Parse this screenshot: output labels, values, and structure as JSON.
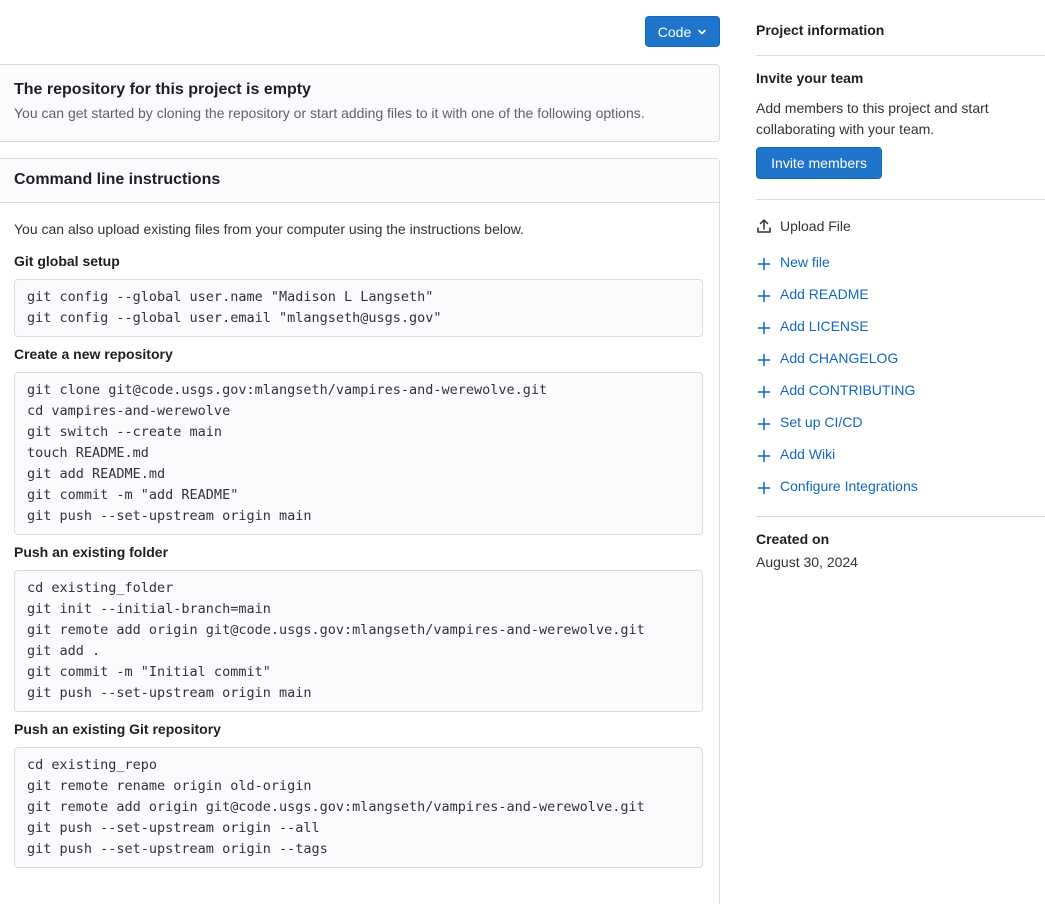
{
  "toolbar": {
    "code_label": "Code"
  },
  "empty_repo": {
    "title": "The repository for this project is empty",
    "subtitle": "You can get started by cloning the repository or start adding files to it with one of the following options."
  },
  "cli": {
    "header": "Command line instructions",
    "intro": "You can also upload existing files from your computer using the instructions below.",
    "sections": [
      {
        "title": "Git global setup",
        "code": "git config --global user.name \"Madison L Langseth\"\ngit config --global user.email \"mlangseth@usgs.gov\""
      },
      {
        "title": "Create a new repository",
        "code": "git clone git@code.usgs.gov:mlangseth/vampires-and-werewolve.git\ncd vampires-and-werewolve\ngit switch --create main\ntouch README.md\ngit add README.md\ngit commit -m \"add README\"\ngit push --set-upstream origin main"
      },
      {
        "title": "Push an existing folder",
        "code": "cd existing_folder\ngit init --initial-branch=main\ngit remote add origin git@code.usgs.gov:mlangseth/vampires-and-werewolve.git\ngit add .\ngit commit -m \"Initial commit\"\ngit push --set-upstream origin main"
      },
      {
        "title": "Push an existing Git repository",
        "code": "cd existing_repo\ngit remote rename origin old-origin\ngit remote add origin git@code.usgs.gov:mlangseth/vampires-and-werewolve.git\ngit push --set-upstream origin --all\ngit push --set-upstream origin --tags"
      }
    ]
  },
  "sidebar": {
    "title": "Project information",
    "invite_title": "Invite your team",
    "invite_text": "Add members to this project and start collaborating with your team.",
    "invite_button": "Invite members",
    "upload_label": "Upload File",
    "links": [
      "New file",
      "Add README",
      "Add LICENSE",
      "Add CHANGELOG",
      "Add CONTRIBUTING",
      "Set up CI/CD",
      "Add Wiki",
      "Configure Integrations"
    ],
    "created_label": "Created on",
    "created_date": "August 30, 2024"
  },
  "colors": {
    "accent": "#1f75cb",
    "link": "#1068bf"
  }
}
